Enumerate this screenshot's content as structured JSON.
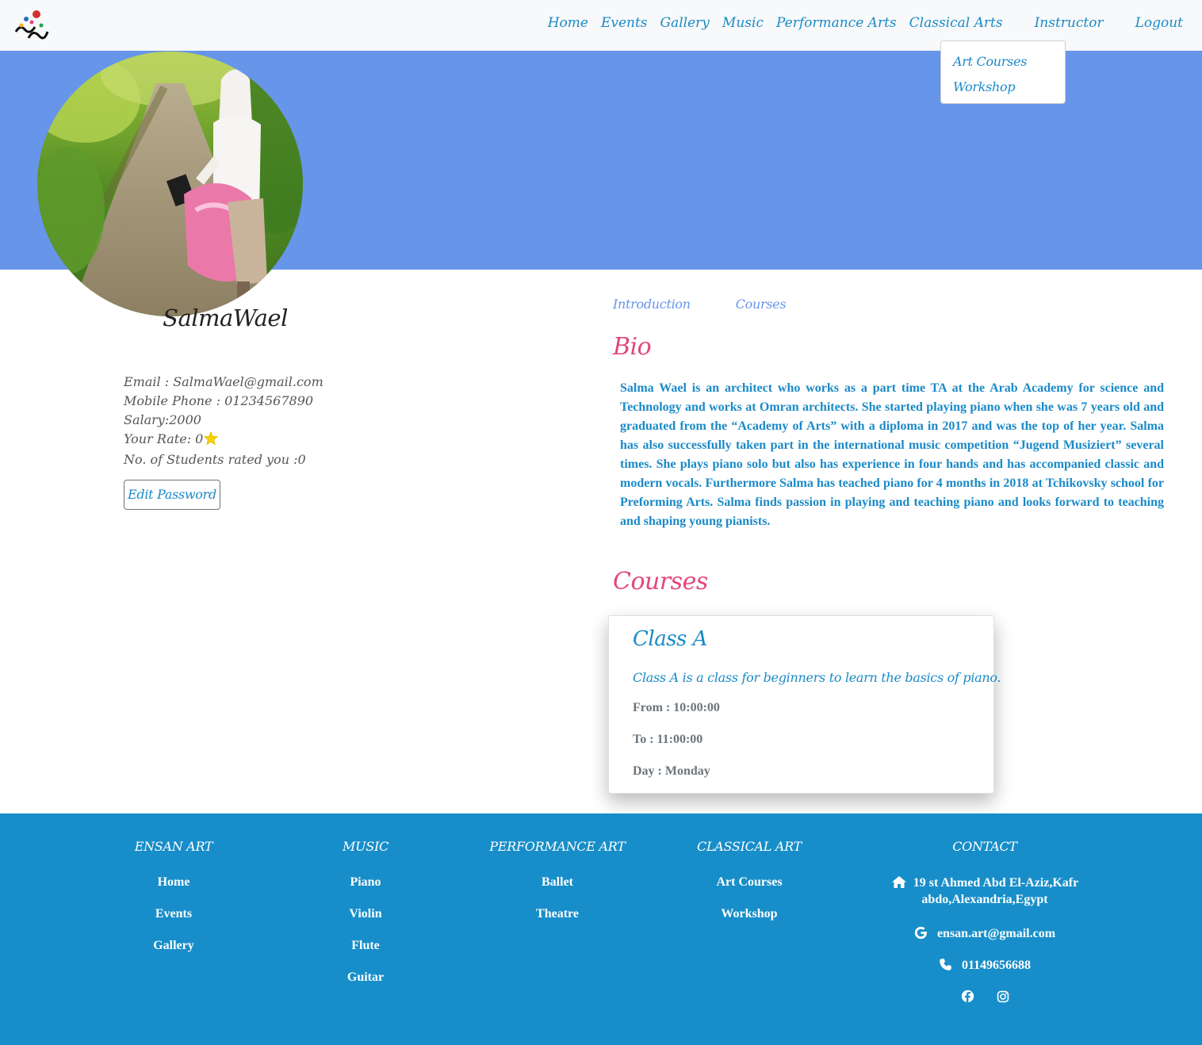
{
  "nav": {
    "logo_text": "إنسان",
    "links": [
      "Home",
      "Events",
      "Gallery",
      "Music",
      "Performance Arts",
      "Classical Arts",
      "Instructor",
      "Logout"
    ],
    "dropdown": [
      "Art Courses",
      "Workshop"
    ]
  },
  "profile": {
    "name": "SalmaWael",
    "email": "Email : SalmaWael@gmail.com",
    "mobile": "Mobile Phone : 01234567890",
    "salary": "Salary:2000",
    "rate": "Your Rate: 0",
    "rated_count": "No. of Students rated you :0",
    "edit_password": "Edit Password"
  },
  "tabs": [
    "Introduction",
    "Courses"
  ],
  "bio": {
    "title": "Bio",
    "text": "Salma Wael is an architect who works as a part time TA at the Arab Academy for science and Technology and works at Omran architects. She started playing piano when she was 7 years old and graduated from the “Academy of Arts” with a diploma in 2017 and was the top of her year. Salma has also successfully taken part in the international music competition “Jugend Musiziert” several times. She plays piano solo but also has experience in four hands and has accompanied classic and modern vocals. Furthermore Salma has teached piano for 4 months in 2018 at Tchikovsky school for Preforming Arts. Salma finds passion in playing and teaching piano and looks forward to teaching and shaping young pianists."
  },
  "courses": {
    "title": "Courses",
    "items": [
      {
        "name": "Class A",
        "description": "Class A is a class for beginners to learn the basics of piano.",
        "from": "From : 10:00:00",
        "to": "To : 11:00:00",
        "day": "Day : Monday"
      }
    ]
  },
  "footer": {
    "ensan": {
      "title": "ENSAN ART",
      "links": [
        "Home",
        "Events",
        "Gallery"
      ]
    },
    "music": {
      "title": "MUSIC",
      "links": [
        "Piano",
        "Violin",
        "Flute",
        "Guitar"
      ]
    },
    "performance": {
      "title": "PERFORMANCE ART",
      "links": [
        "Ballet",
        "Theatre"
      ]
    },
    "classical": {
      "title": "CLASSICAL ART",
      "links": [
        "Art Courses",
        "Workshop"
      ]
    },
    "contact": {
      "title": "CONTACT",
      "address_line1": "19 st Ahmed Abd El-Aziz,Kafr",
      "address_line2": "abdo,Alexandria,Egypt",
      "email": "ensan.art@gmail.com",
      "phone": "01149656688",
      "social": [
        "facebook-icon",
        "instagram-icon"
      ]
    }
  },
  "colors": {
    "navbar_bg": "#f8f9fa",
    "banner_bg": "#6795ea",
    "link": "#1a8ac7",
    "accent_pink": "#e2467e",
    "footer_bg": "#178ec9"
  }
}
